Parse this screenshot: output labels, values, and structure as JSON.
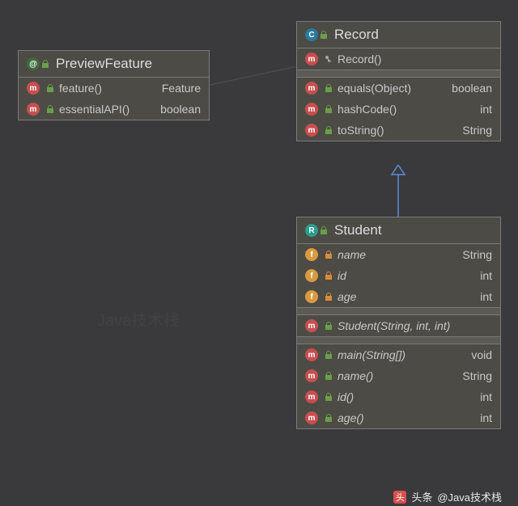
{
  "classes": {
    "previewFeature": {
      "title": "PreviewFeature",
      "members": [
        {
          "name": "feature()",
          "type": "Feature",
          "kind": "method"
        },
        {
          "name": "essentialAPI()",
          "type": "boolean",
          "kind": "method"
        }
      ]
    },
    "record": {
      "title": "Record",
      "constructors": [
        {
          "name": "Record()",
          "kind": "method"
        }
      ],
      "members": [
        {
          "name": "equals(Object)",
          "type": "boolean",
          "kind": "method"
        },
        {
          "name": "hashCode()",
          "type": "int",
          "kind": "method"
        },
        {
          "name": "toString()",
          "type": "String",
          "kind": "method"
        }
      ]
    },
    "student": {
      "title": "Student",
      "fields": [
        {
          "name": "name",
          "type": "String",
          "kind": "field"
        },
        {
          "name": "id",
          "type": "int",
          "kind": "field"
        },
        {
          "name": "age",
          "type": "int",
          "kind": "field"
        }
      ],
      "constructors": [
        {
          "name": "Student(String, int, int)",
          "kind": "method"
        }
      ],
      "members": [
        {
          "name": "main(String[])",
          "type": "void",
          "kind": "method"
        },
        {
          "name": "name()",
          "type": "String",
          "kind": "method"
        },
        {
          "name": "id()",
          "type": "int",
          "kind": "method"
        },
        {
          "name": "age()",
          "type": "int",
          "kind": "method"
        }
      ]
    }
  },
  "footer": {
    "prefix": "头条",
    "handle": "@Java技术栈"
  }
}
